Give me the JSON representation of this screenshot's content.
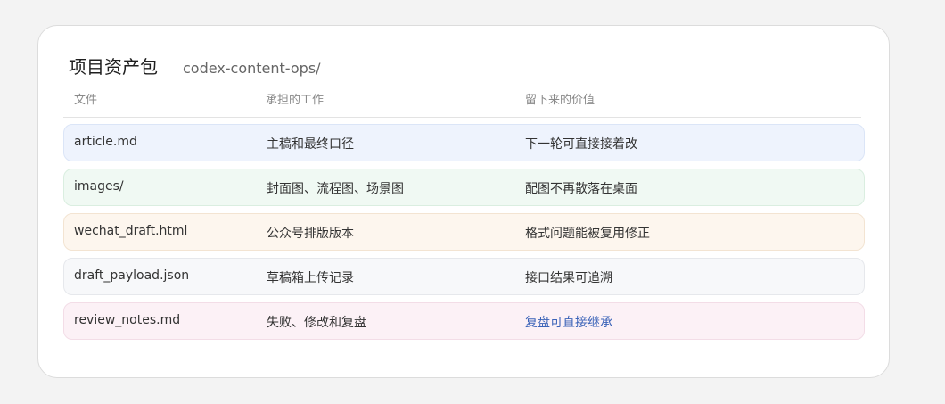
{
  "panel": {
    "title": "项目资产包",
    "path": "codex-content-ops/"
  },
  "table": {
    "headers": [
      "文件",
      "承担的工作",
      "留下来的价值"
    ],
    "rows": [
      {
        "file": "article.md",
        "role": "主稿和最终口径",
        "value": "下一轮可直接接着改"
      },
      {
        "file": "images/",
        "role": "封面图、流程图、场景图",
        "value": "配图不再散落在桌面"
      },
      {
        "file": "wechat_draft.html",
        "role": "公众号排版版本",
        "value": "格式问题能被复用修正"
      },
      {
        "file": "draft_payload.json",
        "role": "草稿箱上传记录",
        "value": "接口结果可追溯"
      },
      {
        "file": "review_notes.md",
        "role": "失败、修改和复盘",
        "value": "复盘可直接继承"
      }
    ]
  },
  "colors": {
    "row_backgrounds": [
      "#eef3fd",
      "#f0f9f3",
      "#fdf6ee",
      "#f7f8fa",
      "#fcf1f6"
    ],
    "link": "#3b63b8"
  }
}
